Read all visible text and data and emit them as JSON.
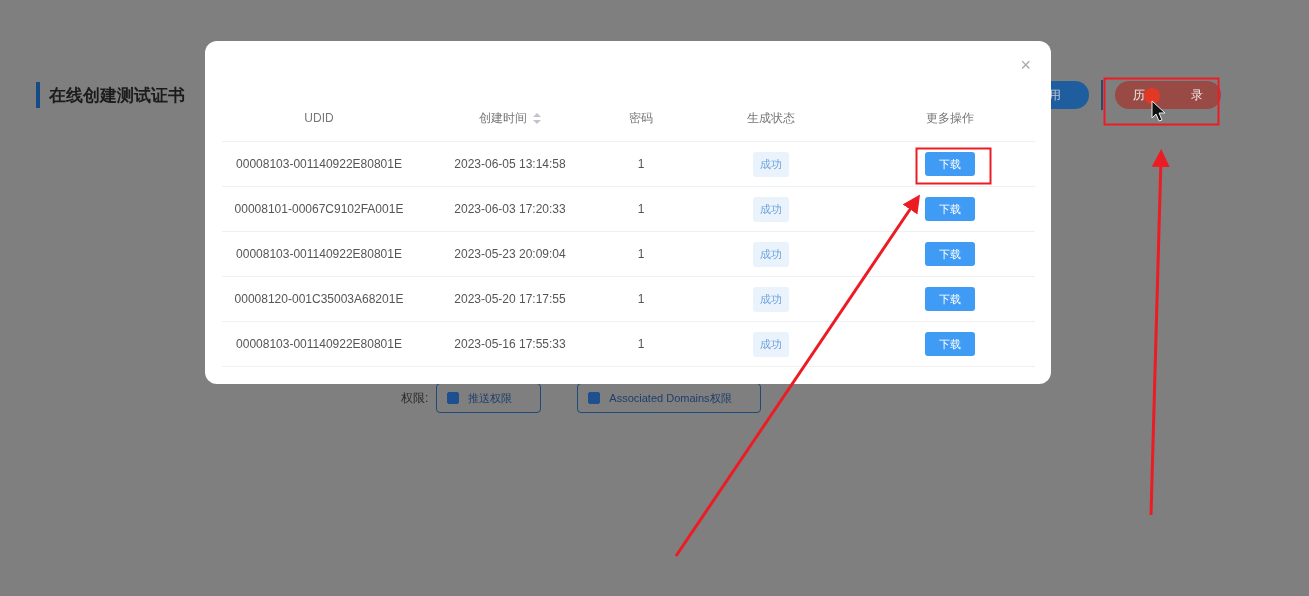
{
  "page": {
    "title": "在线创建测试证书",
    "header_buttons": [
      {
        "kind": "primary",
        "label": "用"
      },
      {
        "kind": "danger",
        "label_parts": [
          "历",
          "录"
        ]
      }
    ],
    "permissions": {
      "label": "权限:",
      "options": [
        {
          "label": "推送权限",
          "checked": true
        },
        {
          "label": "Associated Domains权限",
          "checked": true
        }
      ]
    }
  },
  "dialog": {
    "close": "×",
    "columns": [
      {
        "label": "UDID",
        "sortable": false
      },
      {
        "label": "创建时间",
        "sortable": true
      },
      {
        "label": "密码",
        "sortable": false
      },
      {
        "label": "生成状态",
        "sortable": false
      },
      {
        "label": "更多操作",
        "sortable": false
      }
    ],
    "rows": [
      {
        "udid": "00008103-001140922E80801E",
        "created": "2023-06-05 13:14:58",
        "password": "1",
        "status": "成功",
        "action": "下载"
      },
      {
        "udid": "00008101-00067C9102FA001E",
        "created": "2023-06-03 17:20:33",
        "password": "1",
        "status": "成功",
        "action": "下载"
      },
      {
        "udid": "00008103-001140922E80801E",
        "created": "2023-05-23 20:09:04",
        "password": "1",
        "status": "成功",
        "action": "下载"
      },
      {
        "udid": "00008120-001C35003A68201E",
        "created": "2023-05-20 17:17:55",
        "password": "1",
        "status": "成功",
        "action": "下载"
      },
      {
        "udid": "00008103-001140922E80801E",
        "created": "2023-05-16 17:55:33",
        "password": "1",
        "status": "成功",
        "action": "下载"
      }
    ]
  }
}
